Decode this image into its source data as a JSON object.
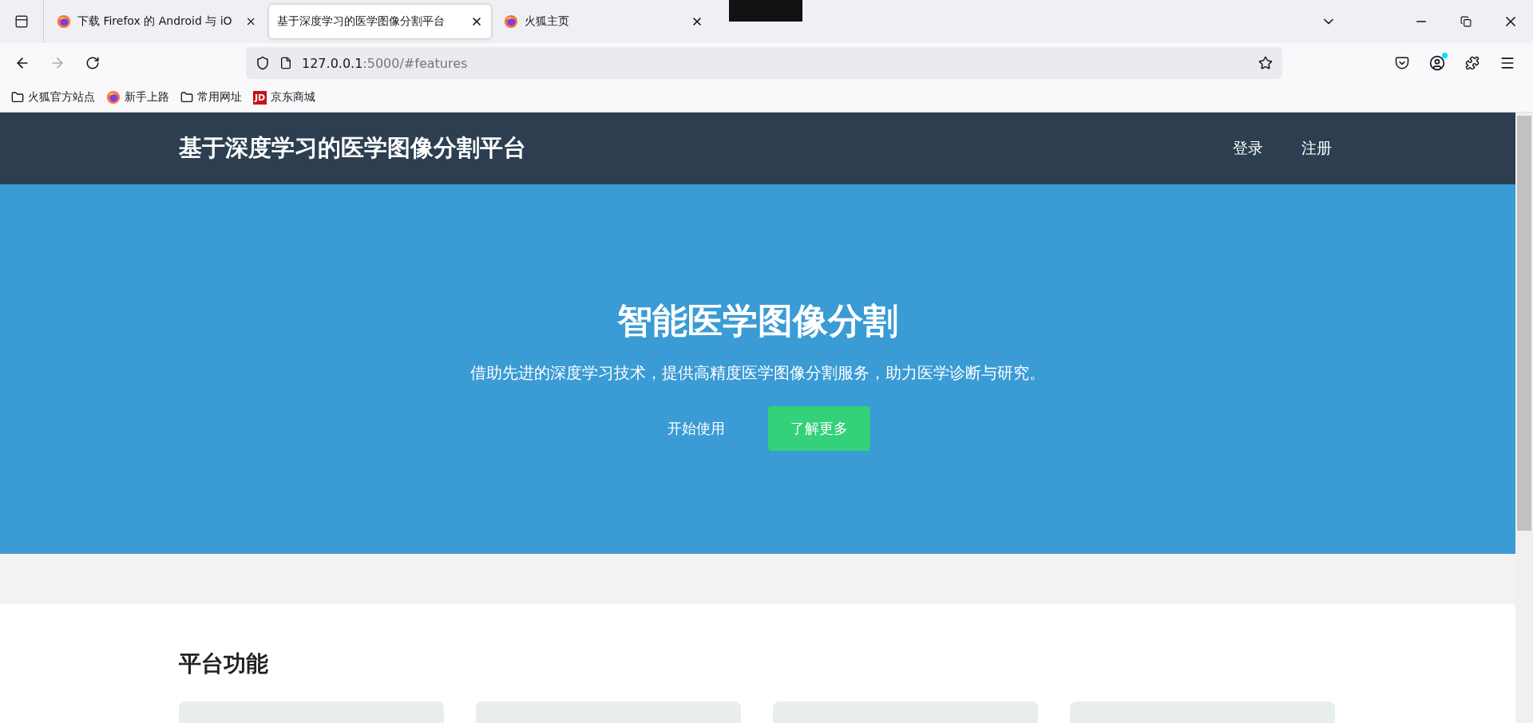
{
  "browser": {
    "tabs": [
      {
        "title": "下载 Firefox 的 Android 与 iO",
        "selected": false,
        "kind": "firefox"
      },
      {
        "title": "基于深度学习的医学图像分割平台",
        "selected": true,
        "kind": "plain"
      },
      {
        "title": "火狐主页",
        "selected": false,
        "kind": "firefox"
      }
    ],
    "url_host": "127.0.0.1",
    "url_rest": ":5000/#features",
    "bookmarks": [
      {
        "label": "火狐官方站点",
        "kind": "folder"
      },
      {
        "label": "新手上路",
        "kind": "firefox"
      },
      {
        "label": "常用网址",
        "kind": "folder"
      },
      {
        "label": "京东商城",
        "kind": "logo",
        "badge": "JD"
      }
    ]
  },
  "site": {
    "brand": "基于深度学习的医学图像分割平台",
    "nav": [
      "登录",
      "注册"
    ],
    "hero": {
      "title": "智能医学图像分割",
      "subtitle": "借助先进的深度学习技术，提供高精度医学图像分割服务，助力医学诊断与研究。",
      "buttons": [
        {
          "label": "开始使用",
          "kind": "plain"
        },
        {
          "label": "了解更多",
          "kind": "filled"
        }
      ]
    },
    "features": {
      "heading": "平台功能"
    }
  }
}
